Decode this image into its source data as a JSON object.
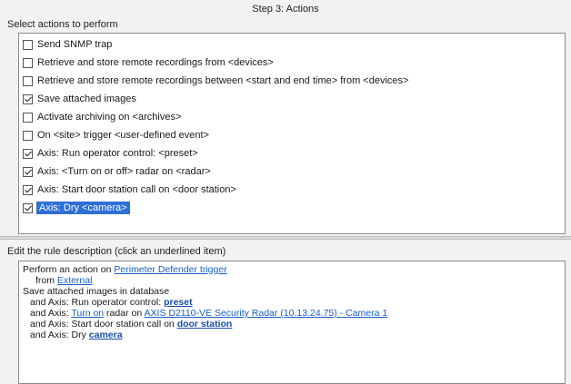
{
  "step_title": "Step 3: Actions",
  "select_label": "Select actions to perform",
  "actions": [
    {
      "label": "Send SNMP trap",
      "checked": false
    },
    {
      "label": "Retrieve and store remote recordings from <devices>",
      "checked": false
    },
    {
      "label": "Retrieve and store remote recordings between <start and end time> from <devices>",
      "checked": false
    },
    {
      "label": "Save attached images",
      "checked": true
    },
    {
      "label": "Activate archiving on <archives>",
      "checked": false
    },
    {
      "label": "On <site> trigger <user-defined event>",
      "checked": false
    },
    {
      "label": "Axis: Run operator control: <preset>",
      "checked": true
    },
    {
      "label": "Axis: <Turn on or off> radar on <radar>",
      "checked": true
    },
    {
      "label": "Axis: Start door station call on <door station>",
      "checked": true
    },
    {
      "label": "Axis: Dry <camera>",
      "checked": true,
      "selected": true
    }
  ],
  "edit_label": "Edit the rule description (click an underlined item)",
  "description": {
    "line1_prefix": "Perform an action on ",
    "line1_link": "Perimeter Defender trigger",
    "line2_prefix": "from ",
    "line2_link": "External",
    "line3": "Save attached images in database",
    "line4_prefix": "and Axis: Run operator control: ",
    "line4_link": "preset",
    "line5_prefix": "and Axis: ",
    "line5_link1": "Turn on",
    "line5_mid": " radar on ",
    "line5_link2": "AXIS D2110-VE Security Radar (10.13.24.75) - Camera 1",
    "line6_prefix": "and Axis: Start door station call on ",
    "line6_link": "door station",
    "line7_prefix": "and Axis: Dry ",
    "line7_link": "camera"
  }
}
